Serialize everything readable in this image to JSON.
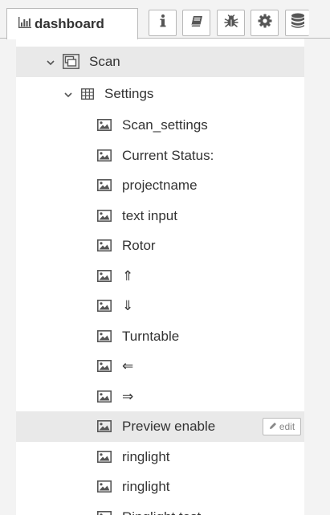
{
  "tabs": {
    "active_label": "dashboard",
    "icons": [
      "info-icon",
      "book-icon",
      "bug-icon",
      "gear-icon",
      "database-icon"
    ]
  },
  "tree": {
    "group": {
      "label": "Scan",
      "expanded": true
    },
    "subgroup": {
      "label": "Settings",
      "expanded": true
    },
    "items": [
      {
        "label": "Scan_settings"
      },
      {
        "label": "Current Status:"
      },
      {
        "label": "projectname"
      },
      {
        "label": "text input"
      },
      {
        "label": "Rotor"
      },
      {
        "label": "⇑"
      },
      {
        "label": "⇓"
      },
      {
        "label": "Turntable"
      },
      {
        "label": "⇐"
      },
      {
        "label": "⇒"
      },
      {
        "label": "Preview enable",
        "hovered": true
      },
      {
        "label": "ringlight"
      },
      {
        "label": "ringlight"
      },
      {
        "label": "Ringlight test"
      }
    ],
    "edit_label": "edit"
  },
  "colors": {
    "text": "#333333",
    "hover_row": "#e9e9e9",
    "panel_bg": "#f3f3f3"
  }
}
